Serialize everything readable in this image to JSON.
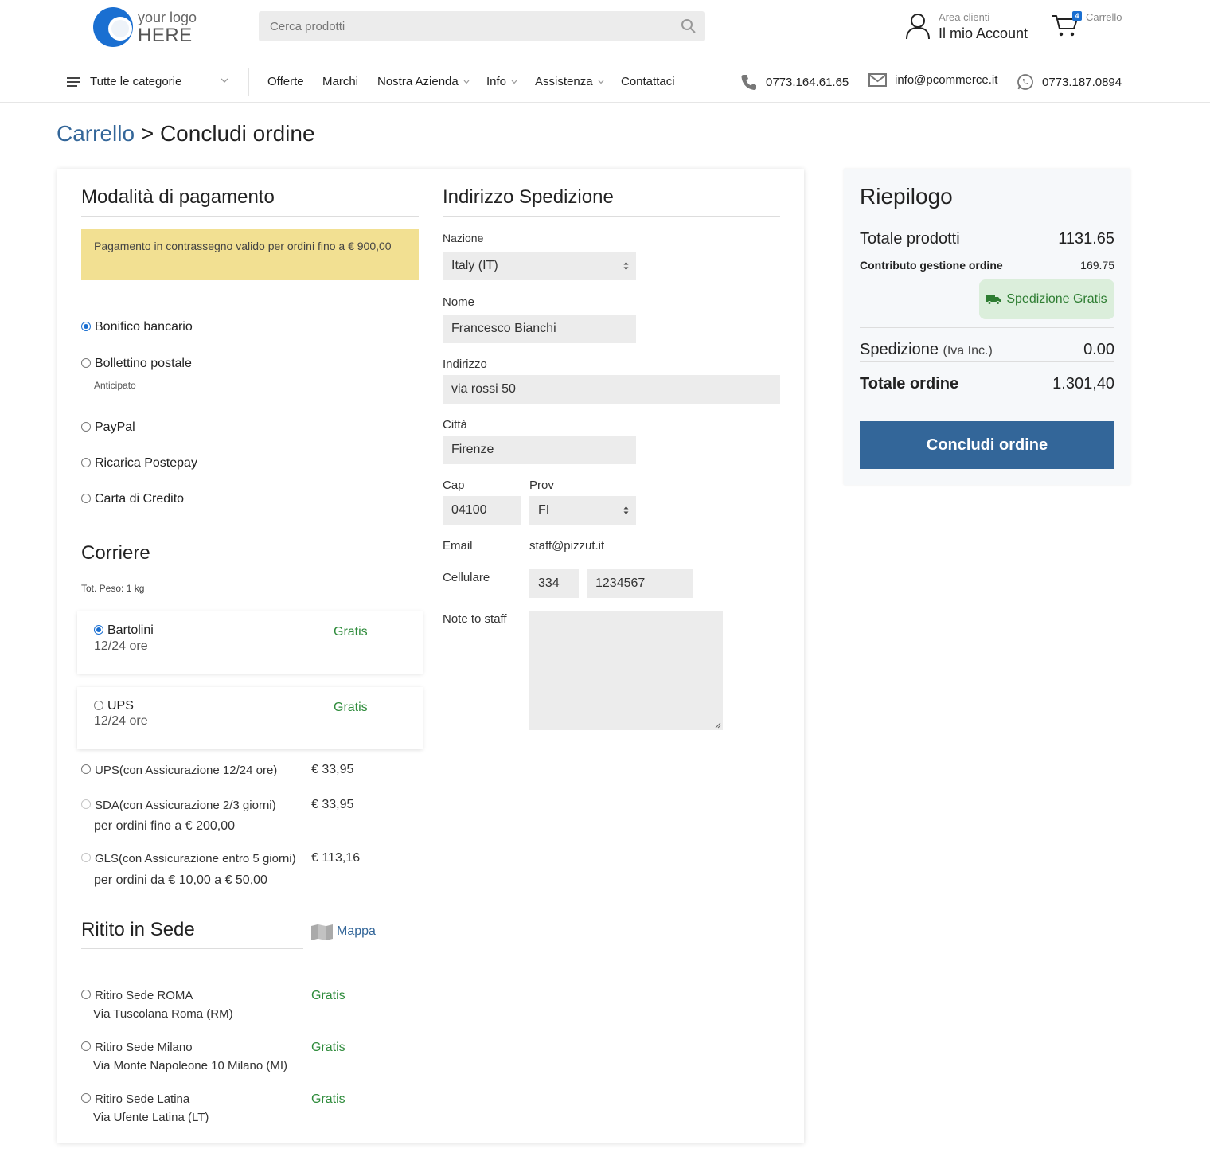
{
  "header": {
    "logo_line1": "your logo",
    "logo_line2": "HERE",
    "search_placeholder": "Cerca prodotti",
    "area_clienti": "Area clienti",
    "account": "Il mio Account",
    "cart_count": "4",
    "cart_label": "Carrello"
  },
  "nav": {
    "categories": "Tutte le categorie",
    "items": [
      "Offerte",
      "Marchi",
      "Nostra Azienda",
      "Info",
      "Assistenza",
      "Contattaci"
    ],
    "phone": "0773.164.61.65",
    "email": "info@pcommerce.it",
    "whatsapp": "0773.187.0894"
  },
  "breadcrumb": {
    "link": "Carrello",
    "separator": ">",
    "current": "Concludi ordine"
  },
  "payment": {
    "title": "Modalità di pagamento",
    "notice": "Pagamento in contrassegno valido per ordini fino a € 900,00",
    "options": [
      {
        "label": "Bonifico bancario",
        "sub": "",
        "checked": true
      },
      {
        "label": "Bollettino postale",
        "sub": "Anticipato",
        "checked": false
      },
      {
        "label": "PayPal",
        "sub": "",
        "checked": false
      },
      {
        "label": "Ricarica Postepay",
        "sub": "",
        "checked": false
      },
      {
        "label": "Carta di Credito",
        "sub": "",
        "checked": false
      }
    ]
  },
  "courier": {
    "title": "Corriere",
    "weight": "Tot. Peso: 1 kg",
    "boxed": [
      {
        "name": "Bartolini",
        "time": "12/24 ore",
        "price": "Gratis",
        "checked": true
      },
      {
        "name": "UPS",
        "time": "12/24 ore",
        "price": "Gratis",
        "checked": false
      }
    ],
    "insured": [
      {
        "name": "UPS(con Assicurazione 12/24 ore)",
        "price": "€ 33,95",
        "note": ""
      },
      {
        "name": "SDA(con Assicurazione 2/3 giorni)",
        "price": "€ 33,95",
        "note": "per ordini fino a € 200,00"
      },
      {
        "name": "GLS(con Assicurazione entro 5 giorni)",
        "price": "€ 113,16",
        "note": "per ordini da € 10,00 a € 50,00"
      }
    ]
  },
  "pickup": {
    "title": "Ritito in Sede",
    "map_link": "Mappa",
    "locations": [
      {
        "name": "Ritiro Sede ROMA",
        "address": "Via Tuscolana Roma (RM)",
        "price": "Gratis"
      },
      {
        "name": "Ritiro Sede Milano",
        "address": "Via Monte Napoleone 10 Milano (MI)",
        "price": "Gratis"
      },
      {
        "name": "Ritiro Sede Latina",
        "address": "Via Ufente Latina (LT)",
        "price": "Gratis"
      }
    ]
  },
  "shipping": {
    "title": "Indirizzo Spedizione",
    "nazione_label": "Nazione",
    "nazione_value": "Italy (IT)",
    "nome_label": "Nome",
    "nome_value": "Francesco Bianchi",
    "indirizzo_label": "Indirizzo",
    "indirizzo_value": "via rossi 50",
    "citta_label": "Città",
    "citta_value": "Firenze",
    "cap_label": "Cap",
    "cap_value": "04100",
    "prov_label": "Prov",
    "prov_value": "FI",
    "email_label": "Email",
    "email_value": "staff@pizzut.it",
    "cell_label": "Cellulare",
    "cell_prefix": "334",
    "cell_number": "1234567",
    "note_label": "Note to staff",
    "note_value": ""
  },
  "summary": {
    "title": "Riepilogo",
    "totale_prodotti_label": "Totale prodotti",
    "totale_prodotti_value": "1131.65",
    "contributo_label": "Contributo gestione ordine",
    "contributo_value": "169.75",
    "free_shipping": "Spedizione Gratis",
    "spedizione_label": "Spedizione",
    "spedizione_note": "(Iva Inc.)",
    "spedizione_value": "0.00",
    "totale_ordine_label": "Totale ordine",
    "totale_ordine_value": "1.301,40",
    "cta": "Concludi ordine"
  },
  "colors": {
    "brand_blue": "#336699",
    "accent_blue": "#1a6fd1",
    "notice_bg": "#f2e092",
    "gratis_green": "#2e8b3b",
    "badge_bg": "#dbeedb"
  }
}
